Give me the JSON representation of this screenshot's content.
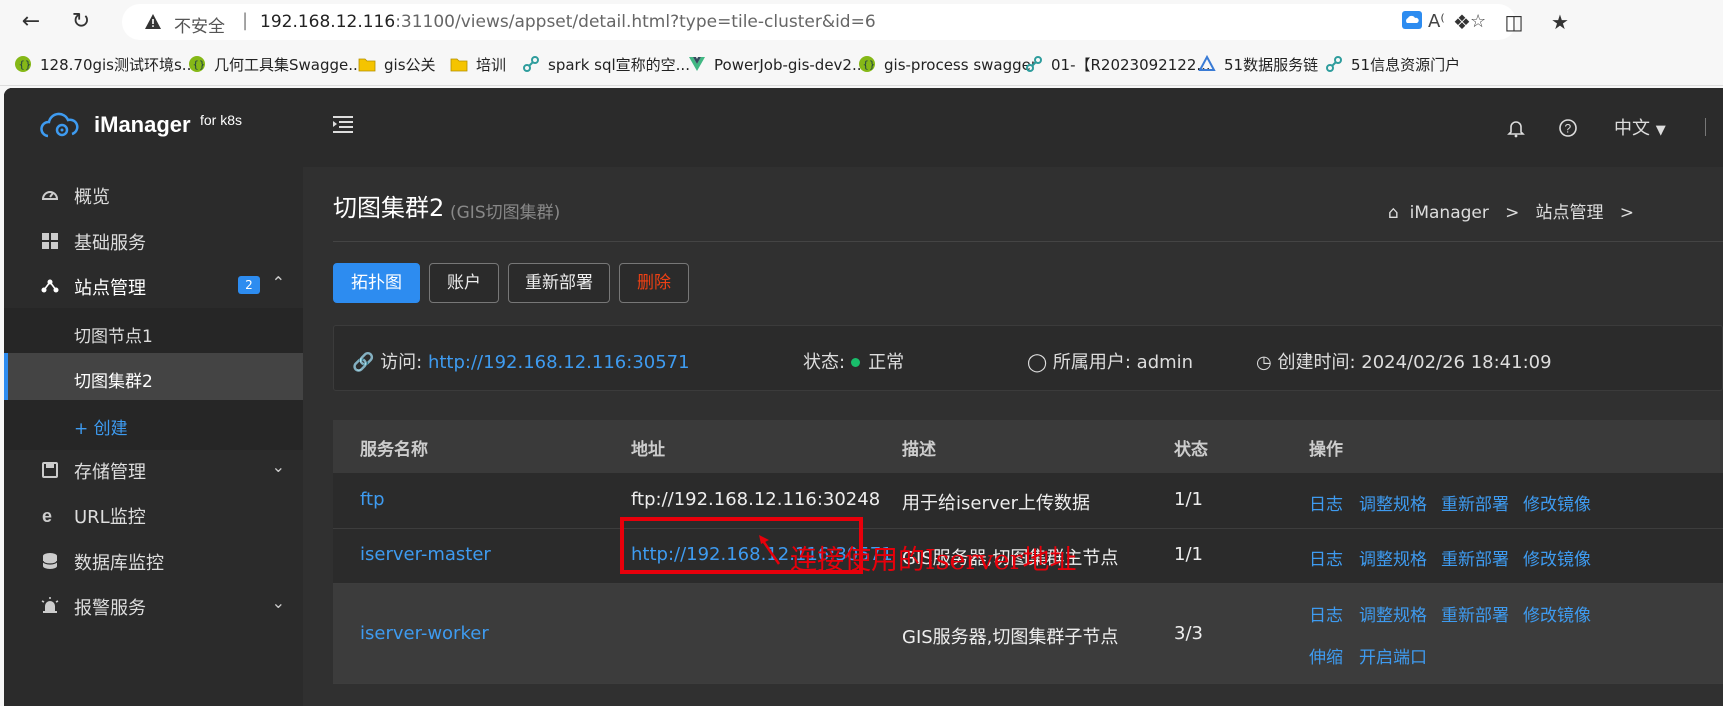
{
  "browser": {
    "insecure_label": "不安全",
    "url_host": "192.168.12.116",
    "url_rest": ":31100/views/appset/detail.html?type=tile-cluster&id=6",
    "bookmarks": [
      {
        "label": "128.70gis测试环境s...",
        "icon": "swagger-icon"
      },
      {
        "label": "几何工具集Swagge...",
        "icon": "swagger-icon"
      },
      {
        "label": "gis公关",
        "icon": "folder-icon"
      },
      {
        "label": "培训",
        "icon": "folder-icon"
      },
      {
        "label": "spark sql宣称的空...",
        "icon": "link-icon"
      },
      {
        "label": "PowerJob-gis-dev2...",
        "icon": "vue-icon"
      },
      {
        "label": "gis-process swagger",
        "icon": "swagger-icon"
      },
      {
        "label": "01-【R2023092122...",
        "icon": "link-icon"
      },
      {
        "label": "51数据服务链",
        "icon": "triangle-icon"
      },
      {
        "label": "51信息资源门户",
        "icon": "link-icon"
      }
    ]
  },
  "app": {
    "logo_text": "iManager",
    "logo_sub": "for k8s",
    "lang": "中文"
  },
  "sidebar": {
    "items": [
      {
        "label": "概览",
        "icon": "dashboard-icon"
      },
      {
        "label": "基础服务",
        "icon": "grid-icon"
      },
      {
        "label": "站点管理",
        "icon": "site-icon",
        "badge": "2"
      },
      {
        "label": "存储管理",
        "icon": "storage-icon"
      },
      {
        "label": "URL监控",
        "icon": "ie-icon"
      },
      {
        "label": "数据库监控",
        "icon": "database-icon"
      },
      {
        "label": "报警服务",
        "icon": "alarm-icon"
      }
    ],
    "sub_items": [
      {
        "label": "切图节点1"
      },
      {
        "label": "切图集群2"
      },
      {
        "label": "+ 创建"
      }
    ]
  },
  "page": {
    "title": "切图集群2",
    "subtitle": "(GIS切图集群)",
    "breadcrumb": [
      "iManager",
      ">",
      "站点管理",
      ">"
    ],
    "buttons": {
      "topology": "拓扑图",
      "account": "账户",
      "redeploy": "重新部署",
      "delete": "删除"
    },
    "info": {
      "access_label": "访问:",
      "access_url": "http://192.168.12.116:30571",
      "status_label": "状态:",
      "status_value": "正常",
      "owner_label": "所属用户: admin",
      "created_label": "创建时间: 2024/02/26 18:41:09"
    }
  },
  "table": {
    "headers": [
      "服务名称",
      "地址",
      "描述",
      "状态",
      "操作"
    ],
    "rows": [
      {
        "name": "ftp",
        "address": "ftp://192.168.12.116:30248",
        "desc": "用于给iserver上传数据",
        "status": "1/1",
        "actions": [
          "日志",
          "调整规格",
          "重新部署",
          "修改镜像"
        ]
      },
      {
        "name": "iserver-master",
        "address": "http://192.168.12.116:30571",
        "desc": "GIS服务器,切图集群主节点",
        "status": "1/1",
        "actions": [
          "日志",
          "调整规格",
          "重新部署",
          "修改镜像"
        ]
      },
      {
        "name": "iserver-worker",
        "address": "",
        "desc": "GIS服务器,切图集群子节点",
        "status": "3/3",
        "actions": [
          "日志",
          "调整规格",
          "重新部署",
          "修改镜像",
          "伸缩",
          "开启端口"
        ]
      }
    ]
  },
  "annotation": "连接使用的Iserver地址",
  "colors": {
    "accent": "#2d8cf0",
    "highlight": "#e8000b",
    "ok": "#19be6b"
  }
}
